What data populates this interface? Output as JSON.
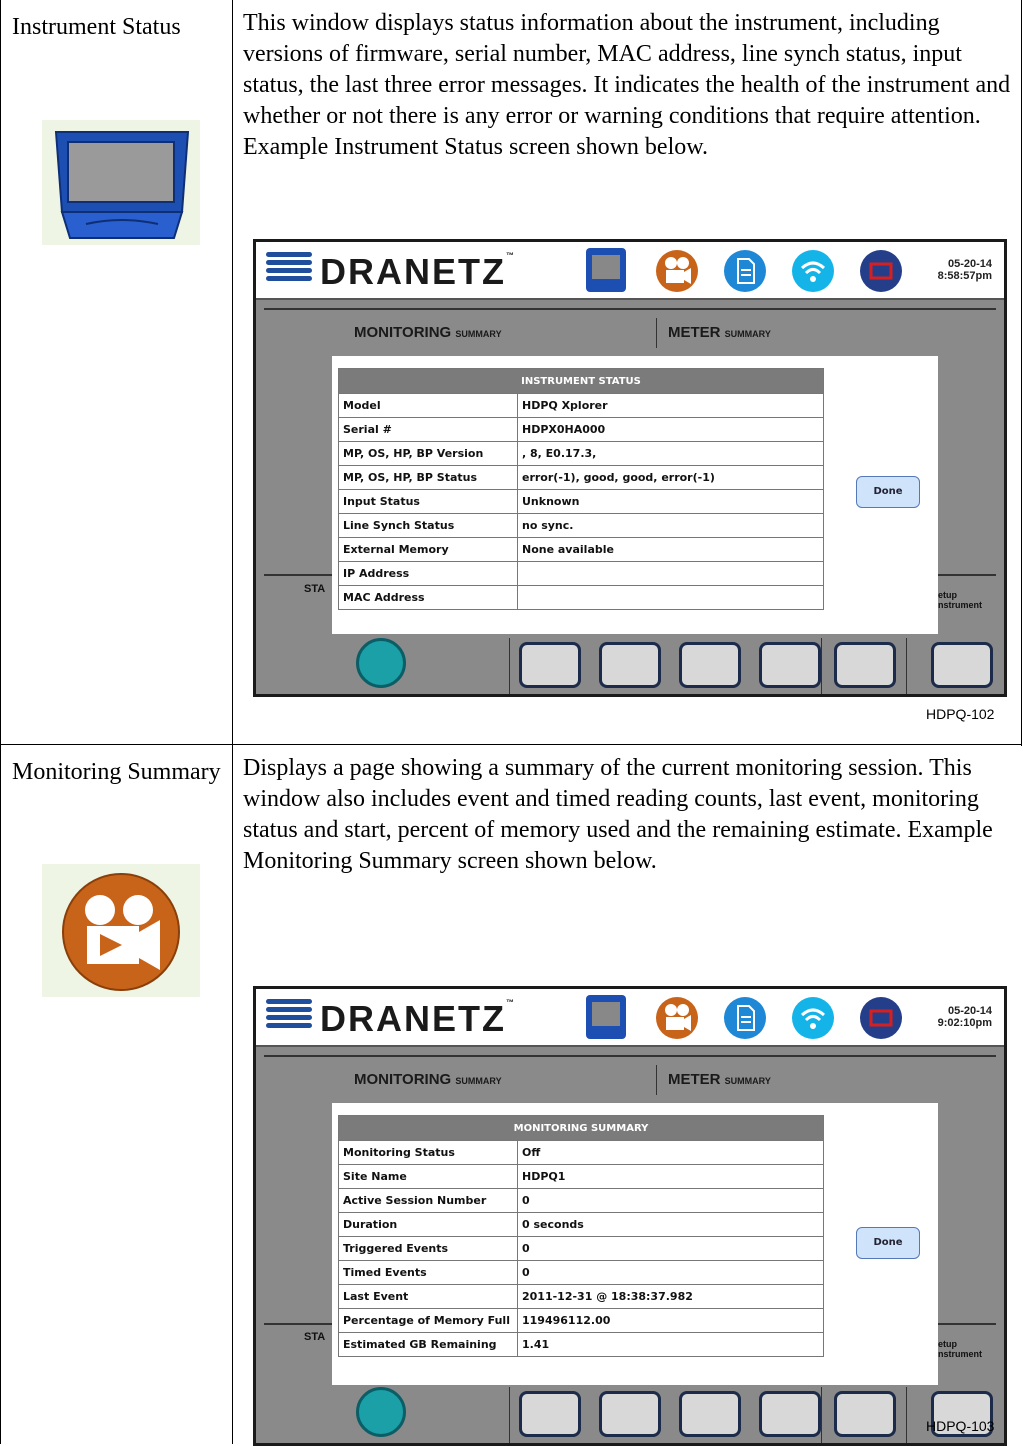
{
  "rows": [
    {
      "label": "Instrument Status",
      "description": "This window displays status information about the instrument, including versions of firmware, serial number, MAC address, line synch status, input status, the last three error messages. It indicates the health of the instrument and whether or not there is any error or warning conditions that require attention. Example Instrument Status screen shown below.",
      "icon": "instrument-status-icon",
      "screenshot": {
        "brand": "DRANETZ",
        "date": "05-20-14",
        "time": "8:58:57pm",
        "monitoring_header": "MONITORING",
        "summary_word": "SUMMARY",
        "meter_header": "METER",
        "status_prefix": "STA",
        "setup_line1": "etup",
        "setup_line2": "nstrument",
        "table_title": "INSTRUMENT STATUS",
        "table": [
          [
            "Model",
            "HDPQ Xplorer"
          ],
          [
            "Serial #",
            "HDPX0HA000"
          ],
          [
            "MP, OS, HP, BP Version",
            ", 8, E0.17.3,"
          ],
          [
            "MP, OS, HP, BP Status",
            "error(-1), good, good, error(-1)"
          ],
          [
            "Input Status",
            "Unknown"
          ],
          [
            "Line Synch Status",
            "no sync."
          ],
          [
            "External Memory",
            "None available"
          ],
          [
            "IP Address",
            ""
          ],
          [
            "MAC Address",
            ""
          ]
        ],
        "done_label": "Done"
      },
      "caption": "HDPQ-102"
    },
    {
      "label": "Monitoring Summary",
      "description": "Displays a page showing a summary of the current monitoring session. This window also includes event and timed reading counts, last event, monitoring status and start, percent of memory used and the remaining estimate. Example Monitoring Summary screen shown below.",
      "icon": "monitoring-summary-icon",
      "screenshot": {
        "brand": "DRANETZ",
        "date": "05-20-14",
        "time": "9:02:10pm",
        "monitoring_header": "MONITORING",
        "summary_word": "SUMMARY",
        "meter_header": "METER",
        "status_prefix": "STA",
        "setup_line1": "etup",
        "setup_line2": "nstrument",
        "table_title": "MONITORING SUMMARY",
        "table": [
          [
            "Monitoring Status",
            "Off"
          ],
          [
            "Site Name",
            "HDPQ1"
          ],
          [
            "Active Session Number",
            "0"
          ],
          [
            "Duration",
            "0 seconds"
          ],
          [
            "Triggered Events",
            "0"
          ],
          [
            "Timed Events",
            "0"
          ],
          [
            "Last Event",
            "2011-12-31 @ 18:38:37.982"
          ],
          [
            "Percentage of Memory Full",
            "119496112.00"
          ],
          [
            "Estimated GB Remaining",
            "1.41"
          ]
        ],
        "done_label": "Done"
      },
      "caption": "HDPQ-103"
    }
  ],
  "colors": {
    "brand_blue": "#1f4e9c",
    "monitor_orange": "#c8641a",
    "report_blue": "#1e88d6",
    "wifi_cyan": "#14b4e8",
    "screen_navy": "#243e8a",
    "screen_red": "#d62020"
  }
}
